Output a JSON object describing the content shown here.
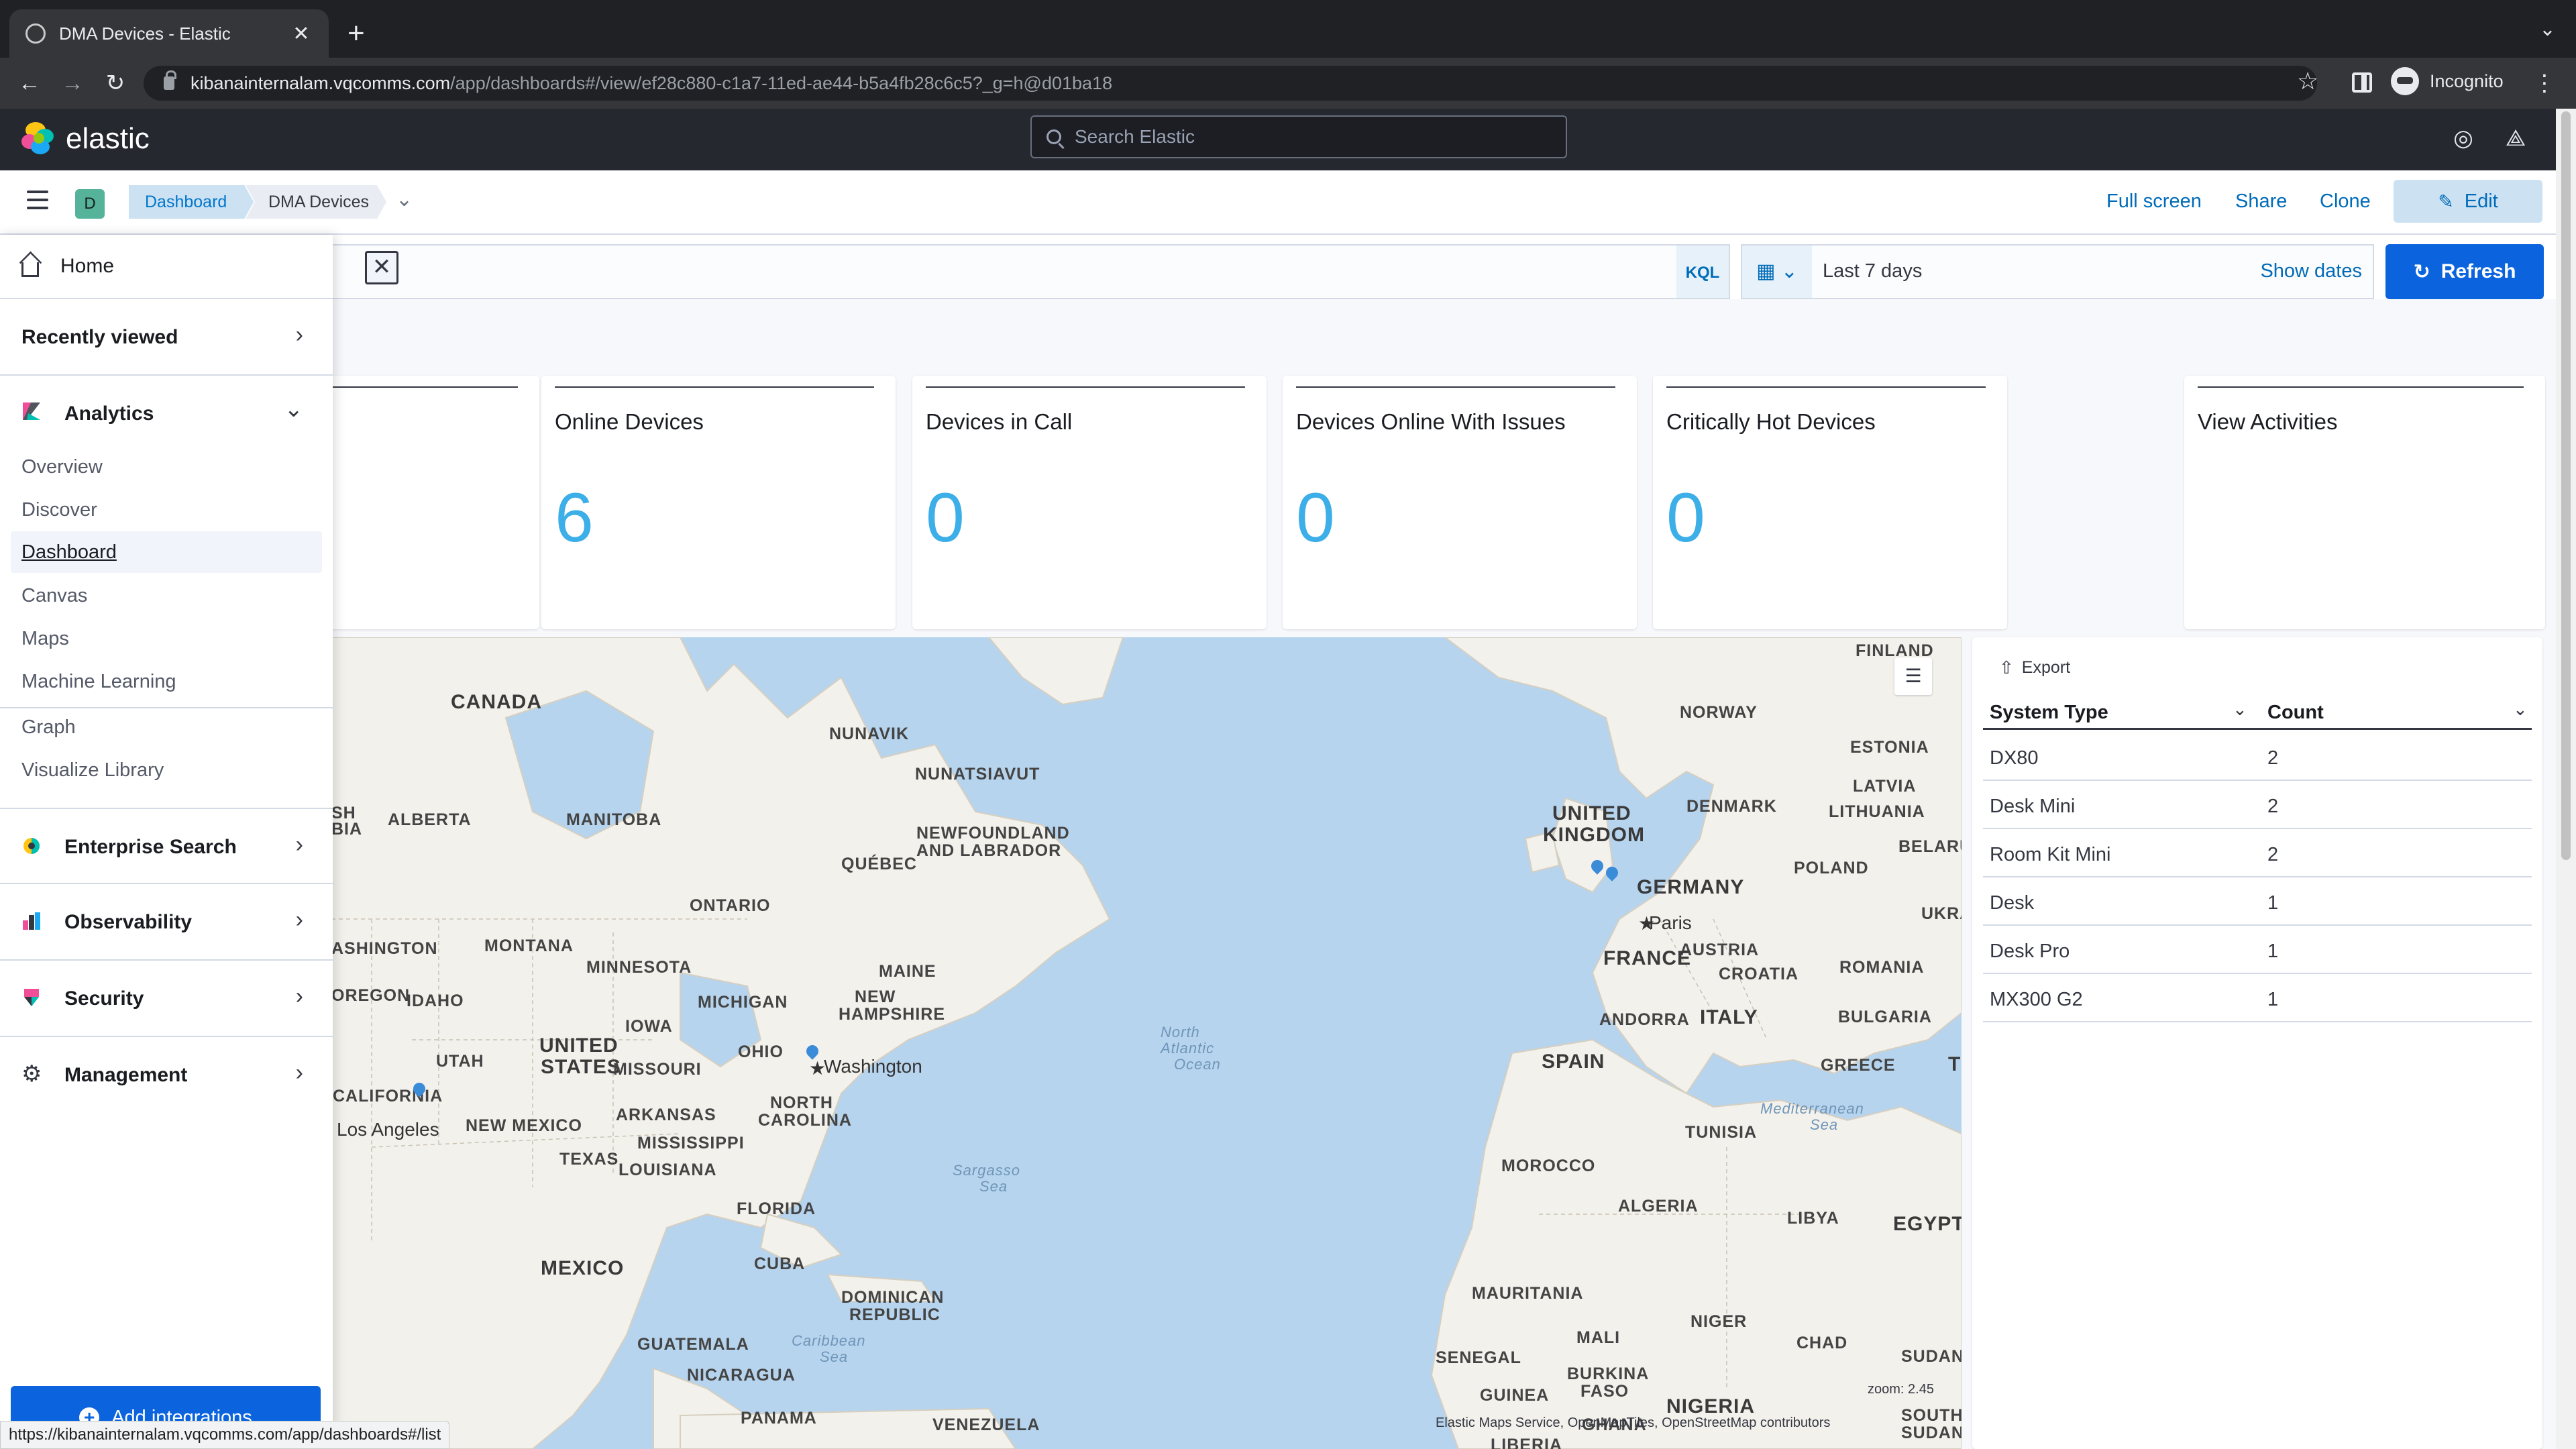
{
  "browser": {
    "tab_title": "DMA Devices - Elastic",
    "tab_close": "✕",
    "new_tab": "+",
    "url_host": "kibanainternalam.vqcomms.com",
    "url_path": "/app/dashboards#/view/ef28c880-c1a7-11ed-ae44-b5a4fb28c6c5?_g=h@d01ba18",
    "profile_label": "Incognito",
    "status_url": "https://kibanainternalam.vqcomms.com/app/dashboards#/list"
  },
  "kibana_header": {
    "logo_text": "elastic",
    "search_placeholder": "Search Elastic"
  },
  "top_nav": {
    "space_initial": "D",
    "breadcrumbs": [
      "Dashboard",
      "DMA Devices"
    ],
    "actions": {
      "full_screen": "Full screen",
      "share": "Share",
      "clone": "Clone",
      "edit": "Edit"
    }
  },
  "query_bar": {
    "clear_glyph": "✕",
    "language": "KQL",
    "time_range": "Last 7 days",
    "show_dates": "Show dates",
    "refresh": "Refresh"
  },
  "side_nav": {
    "home": "Home",
    "recently_viewed": "Recently viewed",
    "analytics": {
      "label": "Analytics",
      "items": [
        "Overview",
        "Discover",
        "Dashboard",
        "Canvas",
        "Maps",
        "Machine Learning",
        "Graph",
        "Visualize Library"
      ],
      "active": "Dashboard"
    },
    "sections": [
      "Enterprise Search",
      "Observability",
      "Security",
      "Management"
    ],
    "add_integrations": "Add integrations"
  },
  "metrics": [
    {
      "title": "Online Devices",
      "value": "6"
    },
    {
      "title": "Devices in Call",
      "value": "0"
    },
    {
      "title": "Devices Online With Issues",
      "value": "0"
    },
    {
      "title": "Critically Hot Devices",
      "value": "0"
    }
  ],
  "view_activities": {
    "title": "View Activities"
  },
  "map": {
    "labels": {
      "canada": "CANADA",
      "nunavik": "NUNAVIK",
      "nunatsiavut": "NUNATSIAVUT",
      "alberta": "ALBERTA",
      "manitoba": "MANITOBA",
      "quebec": "QUÉBEC",
      "newfoundland_1": "NEWFOUNDLAND",
      "newfoundland_2": "AND LABRADOR",
      "ontario": "ONTARIO",
      "bc_1": "SH",
      "bc_2": "BIA",
      "washington_state": "ASHINGTON",
      "montana": "MONTANA",
      "minnesota": "MINNESOTA",
      "maine": "MAINE",
      "michigan": "MICHIGAN",
      "nh_1": "NEW",
      "nh_2": "HAMPSHIRE",
      "oregon": "OREGON",
      "idaho": "IDAHO",
      "iowa": "IOWA",
      "us_1": "UNITED",
      "us_2": "STATES",
      "utah": "UTAH",
      "ohio": "OHIO",
      "missouri": "MISSOURI",
      "california": "CALIFORNIA",
      "washington_city": "Washington",
      "nc_1": "NORTH",
      "nc_2": "CAROLINA",
      "arkansas": "ARKANSAS",
      "los_angeles": "Los Angeles",
      "new_mexico": "NEW MEXICO",
      "mississippi": "MISSISSIPPI",
      "texas": "TEXAS",
      "louisiana": "LOUISIANA",
      "florida": "FLORIDA",
      "mexico": "MEXICO",
      "cuba": "CUBA",
      "dr_1": "DOMINICAN",
      "dr_2": "REPUBLIC",
      "guatemala": "GUATEMALA",
      "nicaragua": "NICARAGUA",
      "panama": "PANAMA",
      "venezuela": "VENEZUELA",
      "atlantic_1": "North",
      "atlantic_2": "Atlantic",
      "atlantic_3": "Ocean",
      "sargasso_1": "Sargasso",
      "sargasso_2": "Sea",
      "caribbean_1": "Caribbean",
      "caribbean_2": "Sea",
      "finland": "FINLAND",
      "norway": "NORWAY",
      "estonia": "ESTONIA",
      "latvia": "LATVIA",
      "uk_1": "UNITED",
      "uk_2": "KINGDOM",
      "denmark": "DENMARK",
      "lithuania": "LITHUANIA",
      "belarus": "BELARUS",
      "poland": "POLAND",
      "germany": "GERMANY",
      "ukraine": "UKRAI",
      "paris": "Paris",
      "austria": "AUSTRIA",
      "france": "FRANCE",
      "croatia": "CROATIA",
      "romania": "ROMANIA",
      "andorra": "ANDORRA",
      "italy": "ITALY",
      "bulgaria": "BULGARIA",
      "spain": "SPAIN",
      "greece": "GREECE",
      "turkey_t": "T",
      "med_1": "Mediterranean",
      "med_2": "Sea",
      "tunisia": "TUNISIA",
      "morocco": "MOROCCO",
      "algeria": "ALGERIA",
      "libya": "LIBYA",
      "egypt": "EGYPT",
      "mauritania": "MAURITANIA",
      "mali": "MALI",
      "niger": "NIGER",
      "chad": "CHAD",
      "senegal": "SENEGAL",
      "bf_1": "BURKINA",
      "bf_2": "FASO",
      "sudan": "SUDAN",
      "guinea": "GUINEA",
      "ghana": "GHANA",
      "nigeria": "NIGERIA",
      "liberia": "LIBERIA",
      "ss_1": "SOUTH",
      "ss_2": "SUDAN"
    },
    "zoom": "zoom: 2.45",
    "attribution": "Elastic Maps Service, OpenMapTiles, OpenStreetMap contributors"
  },
  "system_table": {
    "export": "Export",
    "columns": [
      "System Type",
      "Count"
    ],
    "rows": [
      {
        "type": "DX80",
        "count": "2"
      },
      {
        "type": "Desk Mini",
        "count": "2"
      },
      {
        "type": "Room Kit Mini",
        "count": "2"
      },
      {
        "type": "Desk",
        "count": "1"
      },
      {
        "type": "Desk Pro",
        "count": "1"
      },
      {
        "type": "MX300 G2",
        "count": "1"
      }
    ]
  },
  "colors": {
    "accent": "#0b64dd",
    "metric_value": "#3caee8",
    "map_water": "#b7d4ee",
    "map_land": "#f3f1ec"
  }
}
